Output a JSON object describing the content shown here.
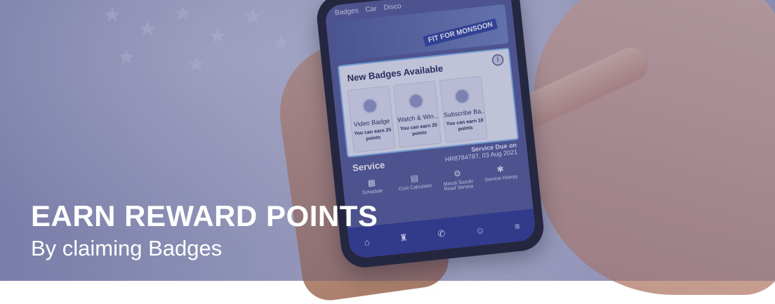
{
  "hero": {
    "headline": "EARN REWARD POINTS",
    "subline": "By claiming Badges"
  },
  "phone": {
    "tabs": [
      "Badges",
      "Car",
      "Disco"
    ],
    "banner_tag": "FIT FOR MONSOON",
    "badges_section": {
      "title": "New Badges Available",
      "info_icon": "info-icon",
      "badges": [
        {
          "name": "Video Badge",
          "points": "You can earn 25 points"
        },
        {
          "name": "Watch & Win...",
          "points": "You can earn 20 points"
        },
        {
          "name": "Subscribe Ba...",
          "points": "You can earn 10 points"
        }
      ]
    },
    "service": {
      "title": "Service",
      "due_label": "Service Due on",
      "due_value": "HR8784787, 03 Aug 2021",
      "items": [
        {
          "label": "Schedule",
          "icon": "calendar-icon"
        },
        {
          "label": "Cost Calculator",
          "icon": "calculator-icon"
        },
        {
          "label": "Maruti Suzuki Road Service",
          "icon": "road-service-icon"
        },
        {
          "label": "Service History",
          "icon": "gear-icon"
        }
      ]
    },
    "navbar": [
      "home-icon",
      "basket-icon",
      "phone-icon",
      "bot-icon",
      "menu-icon"
    ]
  },
  "colors": {
    "overlay": "#464882",
    "navbar": "#2b368e",
    "card_border": "#7fb6e8"
  }
}
